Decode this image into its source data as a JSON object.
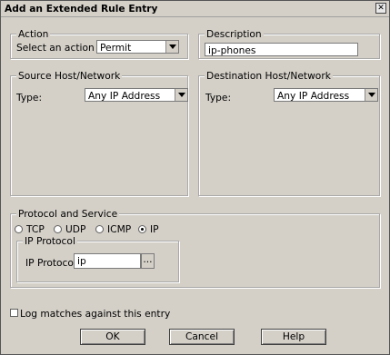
{
  "window": {
    "title": "Add an Extended Rule Entry"
  },
  "action": {
    "group_label": "Action",
    "select_label": "Select an action",
    "value": "Permit"
  },
  "description": {
    "group_label": "Description",
    "value": "ip-phones"
  },
  "source": {
    "group_label": "Source Host/Network",
    "type_label": "Type:",
    "type_value": "Any IP Address"
  },
  "destination": {
    "group_label": "Destination Host/Network",
    "type_label": "Type:",
    "type_value": "Any IP Address"
  },
  "protocol": {
    "group_label": "Protocol and Service",
    "options": [
      "TCP",
      "UDP",
      "ICMP",
      "IP"
    ],
    "selected": "IP",
    "ip_group_label": "IP Protocol",
    "ip_field_label": "IP Protocol",
    "ip_value": "ip",
    "browse_label": "..."
  },
  "log": {
    "label": "Log matches against this entry",
    "checked": false
  },
  "buttons": {
    "ok": "OK",
    "cancel": "Cancel",
    "help": "Help"
  }
}
